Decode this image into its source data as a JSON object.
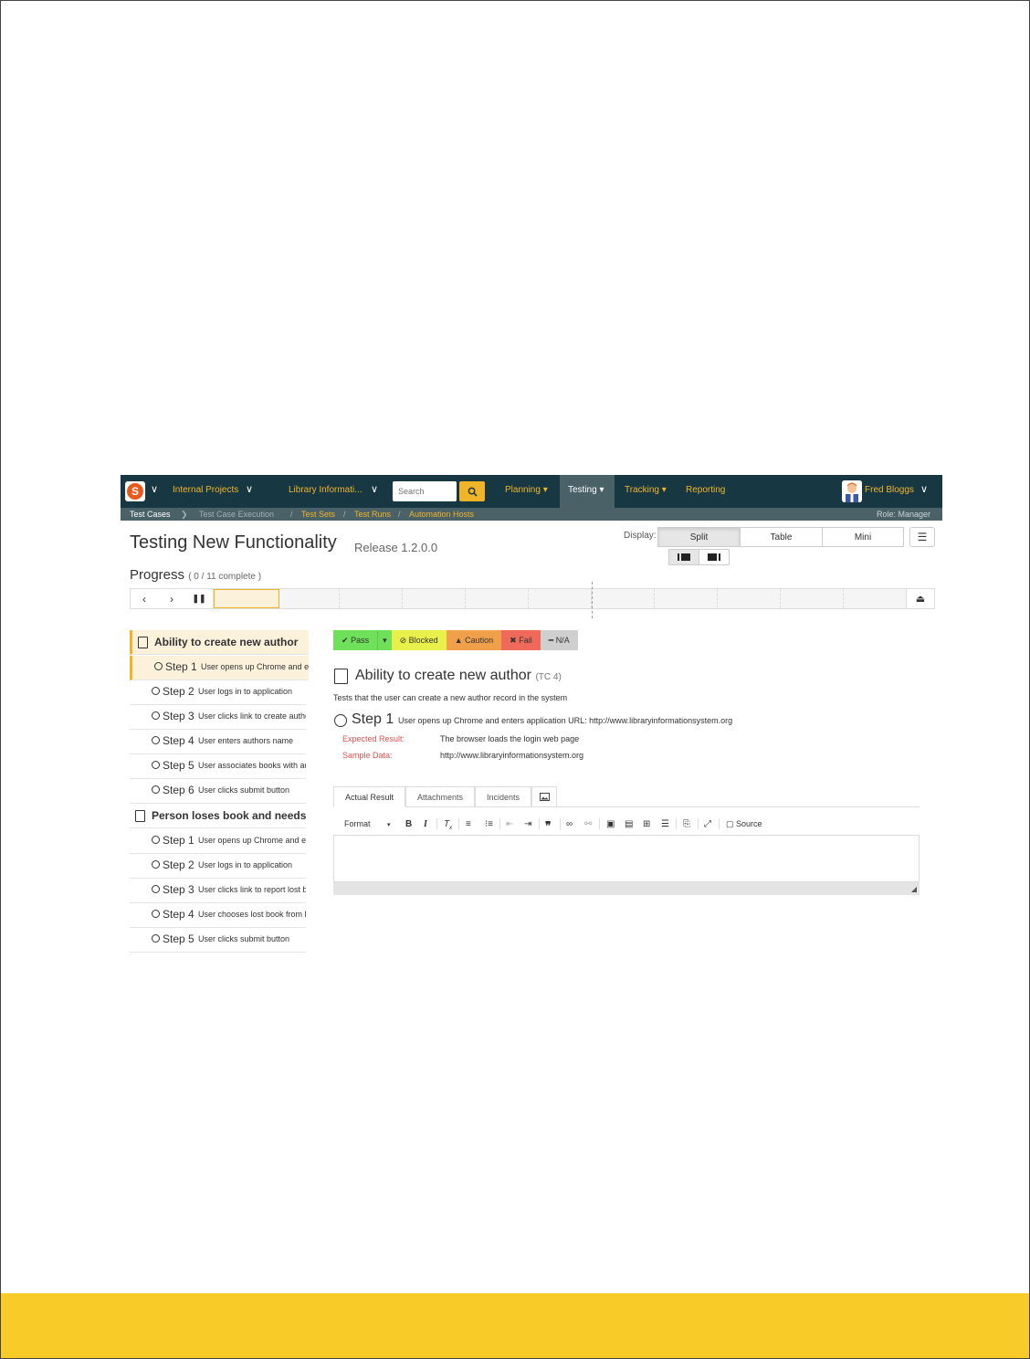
{
  "navbar": {
    "projects": "Internal Projects",
    "product": "Library Informati...",
    "search_placeholder": "Search",
    "menus": [
      "Planning ▾",
      "Testing ▾",
      "Tracking ▾",
      "Reporting"
    ],
    "user": "Fred Bloggs"
  },
  "subnav": {
    "items": [
      "Test Cases",
      "Test Case Execution",
      "Test Sets",
      "Test Runs",
      "Automation Hosts"
    ],
    "role": "Role: Manager"
  },
  "title": "Testing New Functionality",
  "release": "Release 1.2.0.0",
  "display": {
    "label": "Display:",
    "options": [
      "Split",
      "Table",
      "Mini"
    ],
    "selected": "Split"
  },
  "progress": {
    "label": "Progress",
    "count": "( 0 / 11 complete )",
    "completed": 0,
    "total": 11
  },
  "test_cases": [
    {
      "title": "Ability to create new author",
      "steps": [
        {
          "label": "Step 1",
          "desc": "User opens up Chrome and enters application URL"
        },
        {
          "label": "Step 2",
          "desc": "User logs in to application"
        },
        {
          "label": "Step 3",
          "desc": "User clicks link to create author"
        },
        {
          "label": "Step 4",
          "desc": "User enters authors name"
        },
        {
          "label": "Step 5",
          "desc": "User associates books with author"
        },
        {
          "label": "Step 6",
          "desc": "User clicks submit button"
        }
      ]
    },
    {
      "title": "Person loses book and needs to report it",
      "steps": [
        {
          "label": "Step 1",
          "desc": "User opens up Chrome and enters application URL"
        },
        {
          "label": "Step 2",
          "desc": "User logs in to application"
        },
        {
          "label": "Step 3",
          "desc": "User clicks link to report lost book"
        },
        {
          "label": "Step 4",
          "desc": "User chooses lost book from list"
        },
        {
          "label": "Step 5",
          "desc": "User clicks submit button"
        }
      ]
    }
  ],
  "status_buttons": [
    {
      "label": "Pass",
      "icon": "✔",
      "color": "#6ee05a"
    },
    {
      "label": "Blocked",
      "icon": "⊘",
      "color": "#e8f04a"
    },
    {
      "label": "Caution",
      "icon": "▲",
      "color": "#f0a04a"
    },
    {
      "label": "Fail",
      "icon": "✖",
      "color": "#ef6a5a"
    },
    {
      "label": "N/A",
      "icon": "━",
      "color": "#cfcfcf"
    }
  ],
  "detail": {
    "title": "Ability to create new author",
    "tc": "(TC 4)",
    "description": "Tests that the user can create a new author record in the system",
    "step_label": "Step 1",
    "step_desc": "User opens up Chrome and enters application URL: http://www.libraryinformationsystem.org",
    "expected_label": "Expected Result:",
    "expected_value": "The browser loads the login web page",
    "sample_label": "Sample Data:",
    "sample_value": "http://www.libraryinformationsystem.org"
  },
  "tabs": [
    "Actual Result",
    "Attachments",
    "Incidents"
  ],
  "editor": {
    "format_label": "Format",
    "source_label": "Source"
  },
  "colors": {
    "navbar": "#173843",
    "accent": "#f0b429",
    "footer": "#f9cb28"
  }
}
